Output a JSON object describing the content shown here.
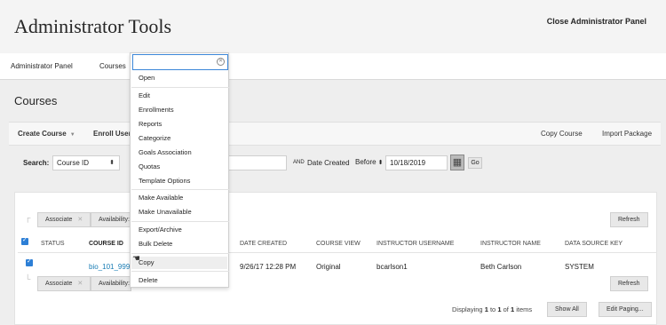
{
  "header": {
    "title": "Administrator Tools",
    "close_label": "Close Administrator Panel"
  },
  "breadcrumbs": [
    "Administrator Panel",
    "Courses"
  ],
  "section_title": "Courses",
  "action_bar": {
    "create_course": "Create Course",
    "enroll_users": "Enroll Users",
    "copy_course": "Copy Course",
    "import_package": "Import Package"
  },
  "search": {
    "label": "Search:",
    "field_value": "Course ID",
    "and_label": "AND",
    "date_label": "Date Created",
    "date_operator": "Before",
    "date_value": "10/18/2019",
    "go_label": "Go"
  },
  "bulk_actions": {
    "associate": "Associate",
    "availability": "Availability:",
    "refresh": "Refresh"
  },
  "table": {
    "headers": [
      "STATUS",
      "COURSE ID",
      "DATE CREATED",
      "COURSE VIEW",
      "INSTRUCTOR USERNAME",
      "INSTRUCTOR NAME",
      "DATA SOURCE KEY"
    ],
    "row": {
      "course_id": "bio_101_999",
      "date_created": "9/26/17 12:28 PM",
      "course_view": "Original",
      "instructor_username": "bcarlson1",
      "instructor_name": "Beth Carlson",
      "data_source_key": "SYSTEM"
    }
  },
  "pagination": {
    "prefix": "Displaying",
    "from": "1",
    "to_word": "to",
    "to": "1",
    "of_word": "of",
    "total": "1",
    "suffix": "items",
    "show_all": "Show All",
    "edit_paging": "Edit Paging..."
  },
  "context_menu": {
    "search_value": "",
    "items": [
      "Open",
      "Edit",
      "Enrollments",
      "Reports",
      "Categorize",
      "Goals Association",
      "Quotas",
      "Template Options",
      "Make Available",
      "Make Unavailable",
      "Export/Archive",
      "Bulk Delete",
      "Copy",
      "Delete"
    ]
  },
  "colors": {
    "accent": "#2d7fd6",
    "link": "#1a7db5"
  }
}
